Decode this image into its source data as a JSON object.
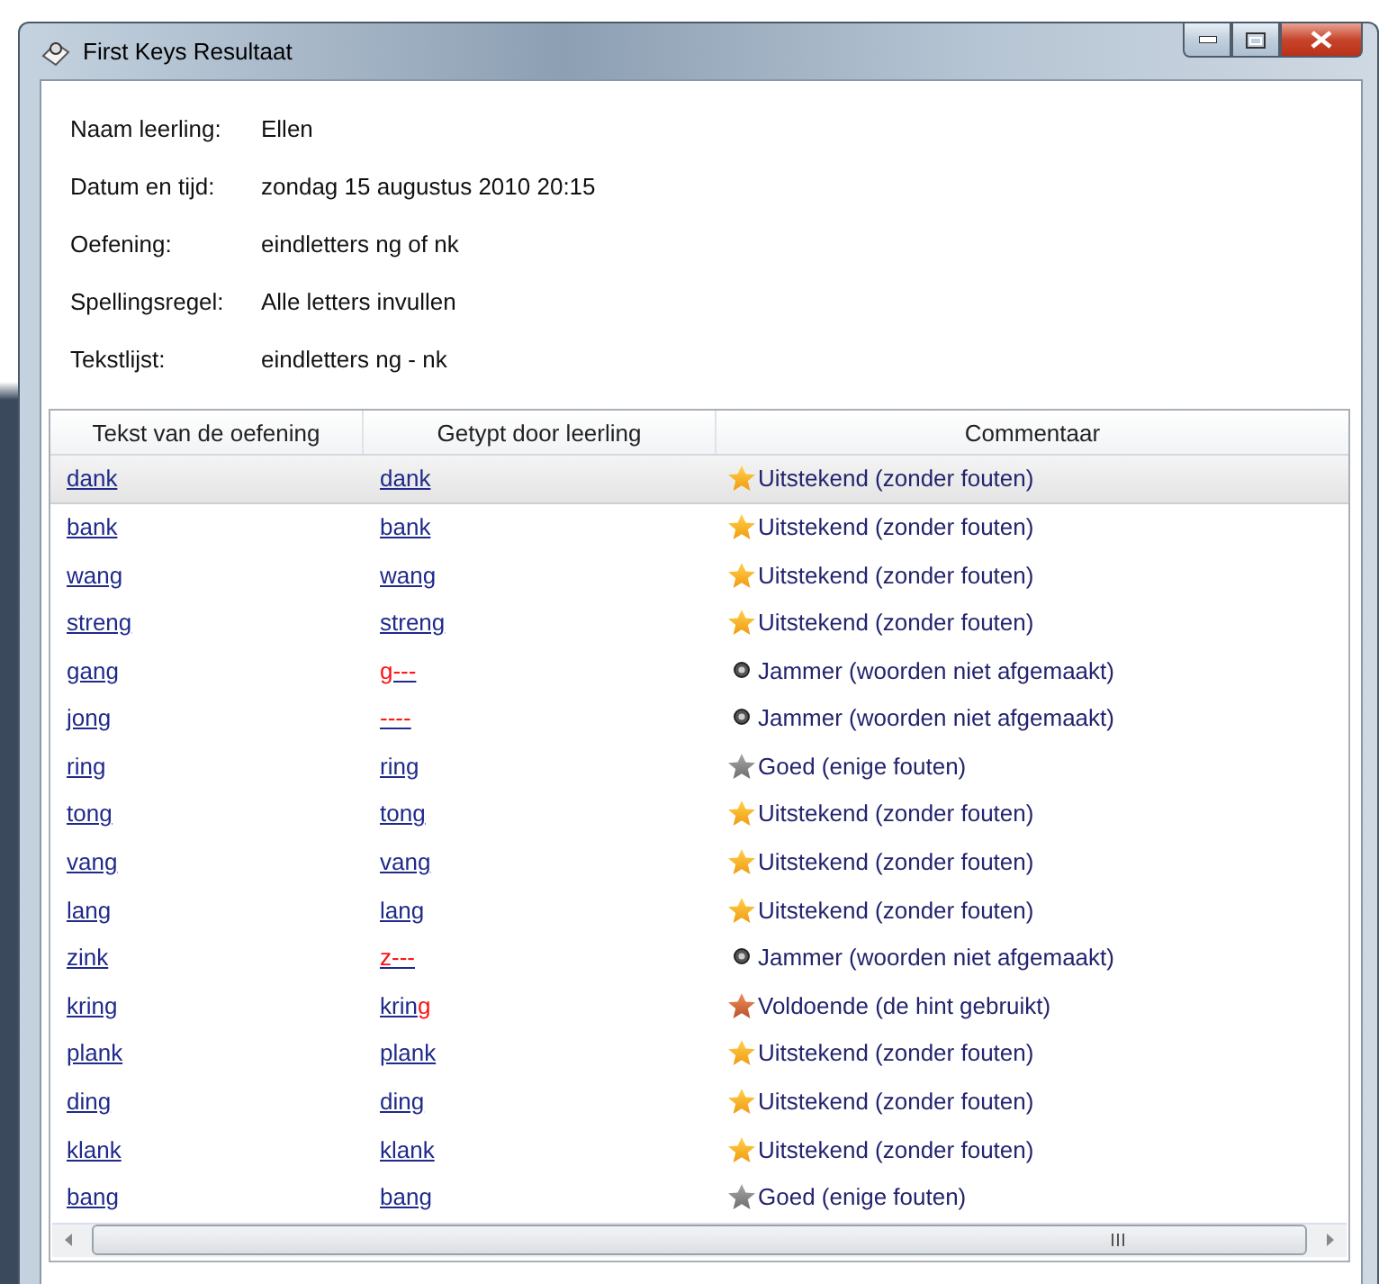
{
  "window": {
    "title": "First Keys Resultaat"
  },
  "info": [
    {
      "label": "Naam leerling:",
      "value": "Ellen"
    },
    {
      "label": "Datum en tijd:",
      "value": "zondag 15 augustus 2010 20:15"
    },
    {
      "label": "Oefening:",
      "value": "eindletters ng of nk"
    },
    {
      "label": "Spellingsregel:",
      "value": "Alle letters invullen"
    },
    {
      "label": "Tekstlijst:",
      "value": "eindletters ng - nk"
    }
  ],
  "table": {
    "columns": [
      "Tekst van de oefening",
      "Getypt door leerling",
      "Commentaar"
    ],
    "rows": [
      {
        "selected": true,
        "text": "dank",
        "typed": [
          {
            "text": "dank",
            "error": false
          }
        ],
        "kind": "gold",
        "comment": "Uitstekend (zonder fouten)"
      },
      {
        "selected": false,
        "text": "bank",
        "typed": [
          {
            "text": "bank",
            "error": false
          }
        ],
        "kind": "gold",
        "comment": "Uitstekend (zonder fouten)"
      },
      {
        "selected": false,
        "text": "wang",
        "typed": [
          {
            "text": "wang",
            "error": false
          }
        ],
        "kind": "gold",
        "comment": "Uitstekend (zonder fouten)"
      },
      {
        "selected": false,
        "text": "streng",
        "typed": [
          {
            "text": "streng",
            "error": false
          }
        ],
        "kind": "gold",
        "comment": "Uitstekend (zonder fouten)"
      },
      {
        "selected": false,
        "text": "gang",
        "typed": [
          {
            "text": "g---",
            "error": true
          }
        ],
        "kind": "dot",
        "comment": "Jammer (woorden niet afgemaakt)"
      },
      {
        "selected": false,
        "text": "jong",
        "typed": [
          {
            "text": "----",
            "error": true
          }
        ],
        "kind": "dot",
        "comment": "Jammer (woorden niet afgemaakt)"
      },
      {
        "selected": false,
        "text": "ring",
        "typed": [
          {
            "text": "ring",
            "error": false
          }
        ],
        "kind": "silver",
        "comment": "Goed (enige fouten)"
      },
      {
        "selected": false,
        "text": "tong",
        "typed": [
          {
            "text": "tong",
            "error": false
          }
        ],
        "kind": "gold",
        "comment": "Uitstekend (zonder fouten)"
      },
      {
        "selected": false,
        "text": "vang",
        "typed": [
          {
            "text": "vang",
            "error": false
          }
        ],
        "kind": "gold",
        "comment": "Uitstekend (zonder fouten)"
      },
      {
        "selected": false,
        "text": "lang",
        "typed": [
          {
            "text": "lang",
            "error": false
          }
        ],
        "kind": "gold",
        "comment": "Uitstekend (zonder fouten)"
      },
      {
        "selected": false,
        "text": "zink",
        "typed": [
          {
            "text": "z---",
            "error": true
          }
        ],
        "kind": "dot",
        "comment": "Jammer (woorden niet afgemaakt)"
      },
      {
        "selected": false,
        "text": "kring",
        "typed": [
          {
            "text": "krin",
            "error": false
          },
          {
            "text": "g",
            "error": true
          }
        ],
        "kind": "bronze",
        "comment": "Voldoende (de hint gebruikt)"
      },
      {
        "selected": false,
        "text": "plank",
        "typed": [
          {
            "text": "plank",
            "error": false
          }
        ],
        "kind": "gold",
        "comment": "Uitstekend (zonder fouten)"
      },
      {
        "selected": false,
        "text": "ding",
        "typed": [
          {
            "text": "ding",
            "error": false
          }
        ],
        "kind": "gold",
        "comment": "Uitstekend (zonder fouten)"
      },
      {
        "selected": false,
        "text": "klank",
        "typed": [
          {
            "text": "klank",
            "error": false
          }
        ],
        "kind": "gold",
        "comment": "Uitstekend (zonder fouten)"
      },
      {
        "selected": false,
        "text": "bang",
        "typed": [
          {
            "text": "bang",
            "error": false
          }
        ],
        "kind": "silver",
        "comment": "Goed (enige fouten)"
      }
    ]
  }
}
